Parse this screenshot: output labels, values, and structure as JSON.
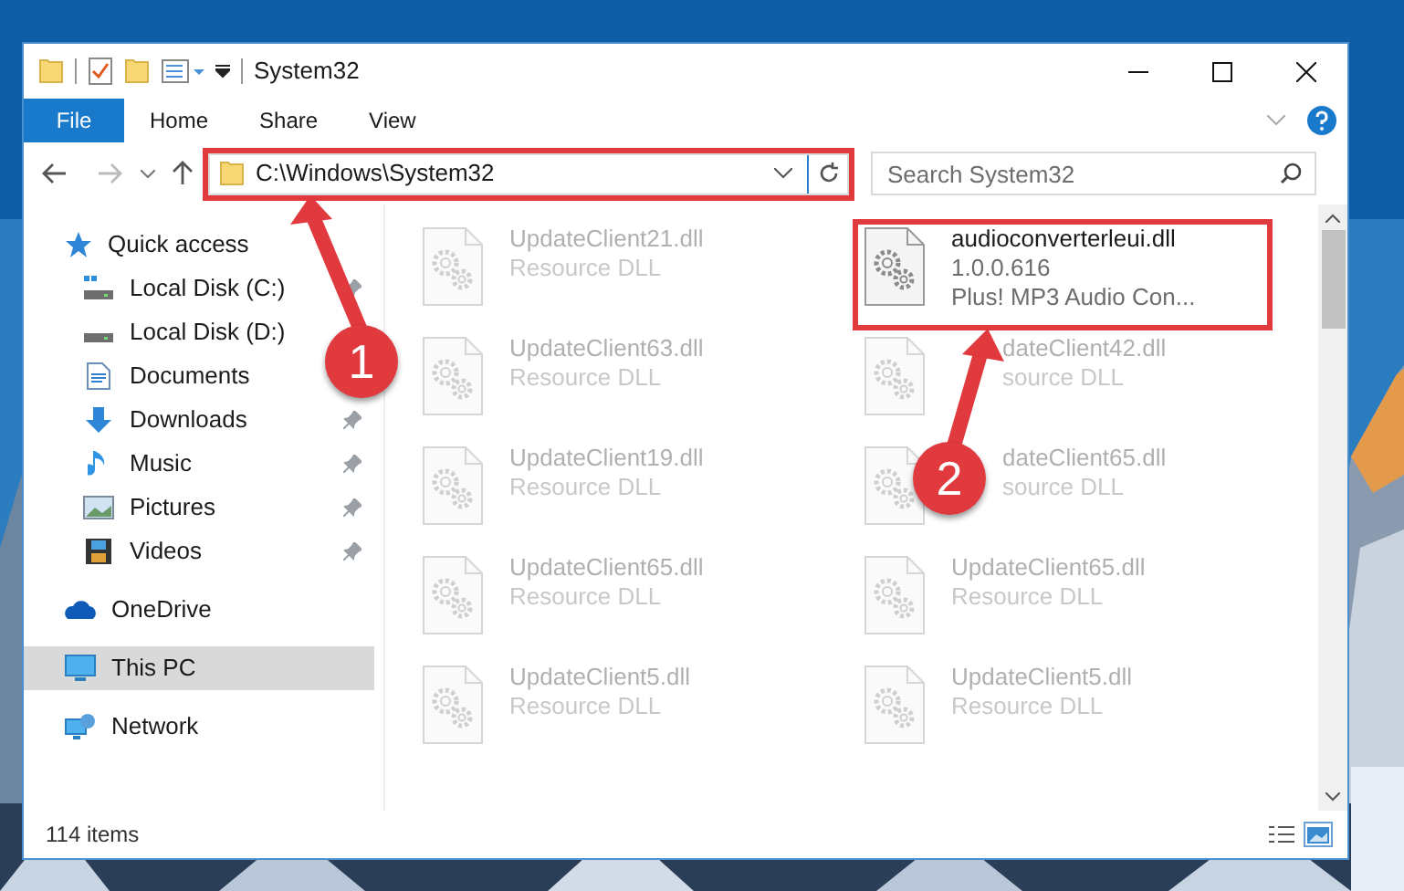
{
  "window": {
    "title": "System32"
  },
  "ribbon": {
    "tabs": [
      {
        "label": "File",
        "kind": "file",
        "selected": false
      },
      {
        "label": "Home",
        "kind": "tab",
        "selected": false
      },
      {
        "label": "Share",
        "kind": "tab",
        "selected": false
      },
      {
        "label": "View",
        "kind": "tab",
        "selected": false
      }
    ]
  },
  "address": {
    "path": "C:\\Windows\\System32",
    "highlighted": true,
    "search_placeholder": "Search System32"
  },
  "sidebar": {
    "items": [
      {
        "label": "Quick access",
        "selected": false,
        "children": [
          {
            "label": "Local Disk (C:)",
            "pinned": true
          },
          {
            "label": "Local Disk (D:)",
            "pinned": false
          },
          {
            "label": "Documents",
            "pinned": false
          },
          {
            "label": "Downloads",
            "pinned": true
          },
          {
            "label": "Music",
            "pinned": true
          },
          {
            "label": "Pictures",
            "pinned": true
          },
          {
            "label": "Videos",
            "pinned": true
          }
        ]
      },
      {
        "label": "OneDrive",
        "selected": false
      },
      {
        "label": "This PC",
        "selected": true
      },
      {
        "label": "Network",
        "selected": false
      }
    ]
  },
  "files": [
    {
      "kind": "tile",
      "name": "UpdateClient21.dll",
      "details": [
        "Resource DLL"
      ],
      "dimmed": true,
      "highlighted": false
    },
    {
      "kind": "tile",
      "name": "audioconverterleui.dll",
      "details": [
        "1.0.0.616",
        "Plus! MP3 Audio Con..."
      ],
      "dimmed": false,
      "highlighted": true
    },
    {
      "kind": "tile",
      "name": "UpdateClient63.dll",
      "details": [
        "Resource DLL"
      ],
      "dimmed": true,
      "highlighted": false
    },
    {
      "kind": "partly_covered",
      "name": "dateClient42.dll",
      "details": [
        "source DLL"
      ],
      "dimmed": true,
      "highlighted": false
    },
    {
      "kind": "tile",
      "name": "UpdateClient19.dll",
      "details": [
        "Resource DLL"
      ],
      "dimmed": true,
      "highlighted": false
    },
    {
      "kind": "partly_covered",
      "name": "dateClient65.dll",
      "details": [
        "source DLL"
      ],
      "dimmed": true,
      "highlighted": false
    },
    {
      "kind": "tile",
      "name": "UpdateClient65.dll",
      "details": [
        "Resource DLL"
      ],
      "dimmed": true,
      "highlighted": false
    },
    {
      "kind": "tile",
      "name": "UpdateClient65.dll",
      "details": [
        "Resource DLL"
      ],
      "dimmed": true,
      "highlighted": false
    },
    {
      "kind": "tile",
      "name": "UpdateClient5.dll",
      "details": [
        "Resource DLL"
      ],
      "dimmed": true,
      "highlighted": false
    },
    {
      "kind": "tile",
      "name": "UpdateClient5.dll",
      "details": [
        "Resource DLL"
      ],
      "dimmed": true,
      "highlighted": false
    }
  ],
  "status_bar": {
    "item_count": "114 items",
    "view_modes": [
      {
        "selected": false
      },
      {
        "selected": true
      }
    ]
  },
  "annotations": [
    {
      "label": "1"
    },
    {
      "label": "2"
    }
  ]
}
